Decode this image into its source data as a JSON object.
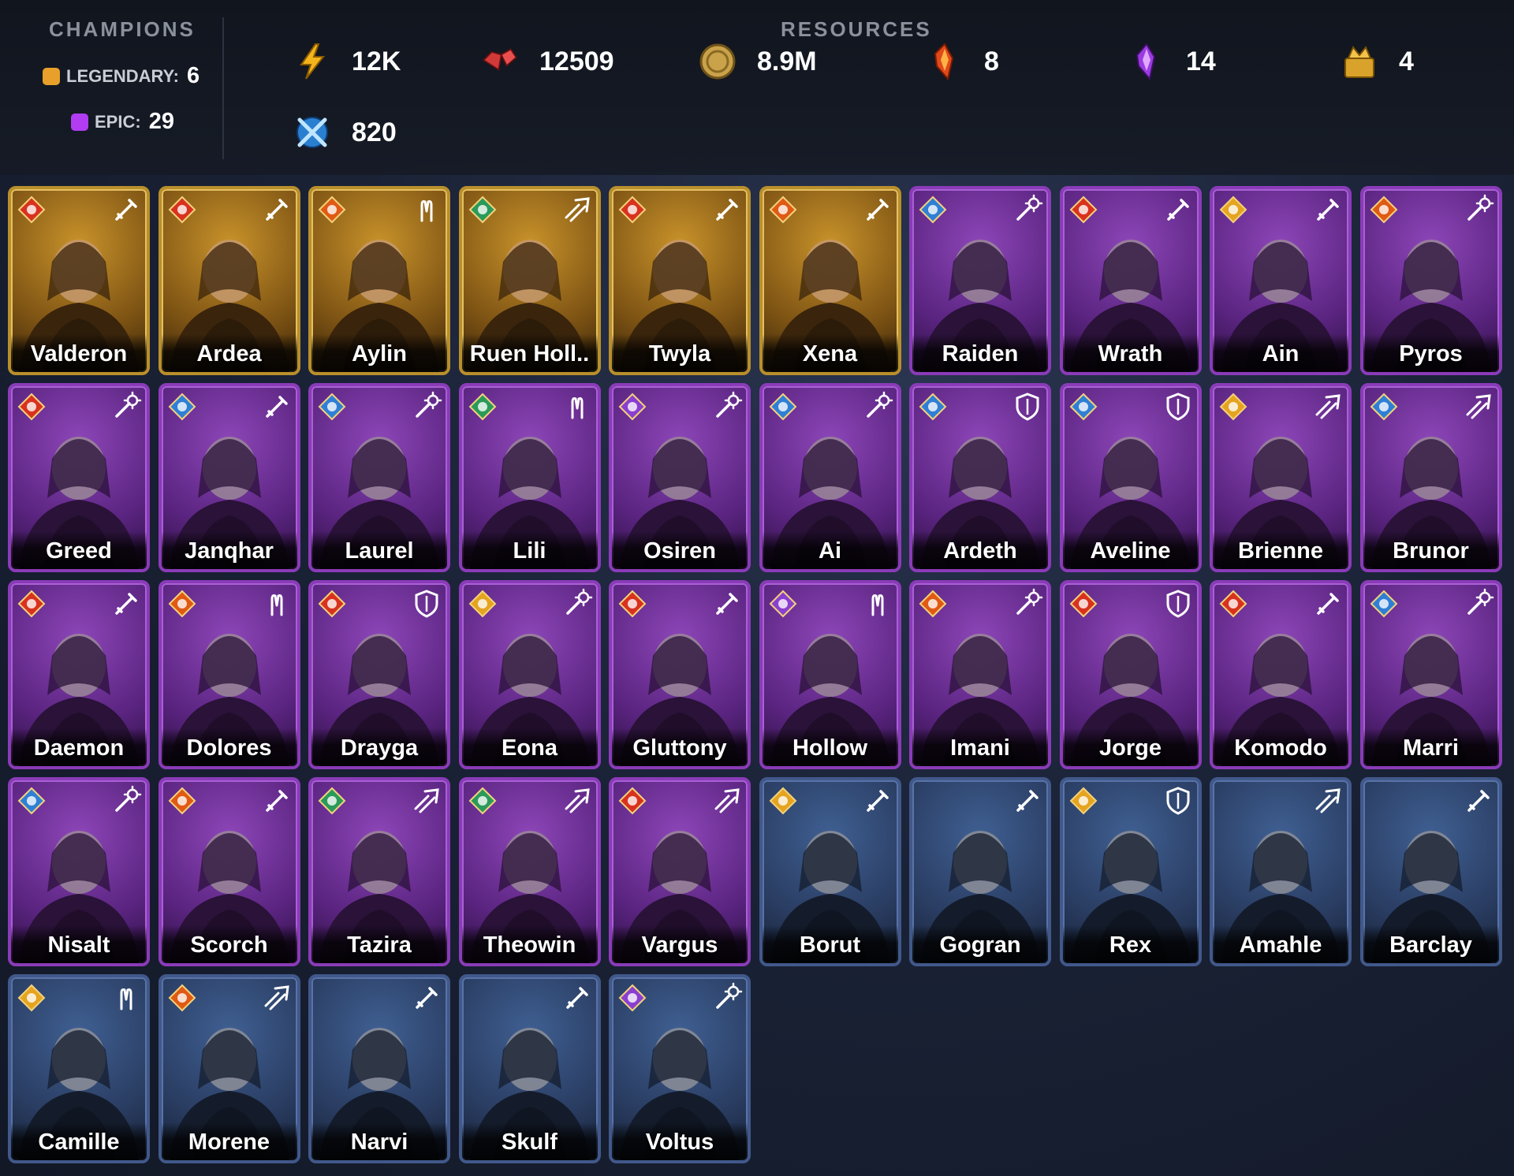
{
  "header": {
    "champions_title": "CHAMPIONS",
    "legendary_label": "LEGENDARY:",
    "legendary_count": "6",
    "epic_label": "EPIC:",
    "epic_count": "29",
    "resources_title": "RESOURCES",
    "resources": [
      {
        "icon": "energy-bolt-icon",
        "value": "12K"
      },
      {
        "icon": "gem-icon",
        "value": "12509"
      },
      {
        "icon": "silver-coin-icon",
        "value": "8.9M"
      },
      {
        "icon": "red-shard-icon",
        "value": "8"
      },
      {
        "icon": "purple-shard-icon",
        "value": "14"
      },
      {
        "icon": "gold-tokens-icon",
        "value": "4"
      },
      {
        "icon": "arena-token-icon",
        "value": "820"
      }
    ]
  },
  "colors": {
    "legendary": "#e8a02a",
    "epic": "#b13cf2",
    "rare": "#4a66a0"
  },
  "champions": [
    {
      "name": "Valderon",
      "rarity": "legendary",
      "role": "attack",
      "affinity": "force"
    },
    {
      "name": "Ardea",
      "rarity": "legendary",
      "role": "attack",
      "affinity": "force"
    },
    {
      "name": "Aylin",
      "rarity": "legendary",
      "role": "support",
      "affinity": "fire"
    },
    {
      "name": "Ruen Holl..",
      "rarity": "legendary",
      "role": "speed",
      "affinity": "nature"
    },
    {
      "name": "Twyla",
      "rarity": "legendary",
      "role": "attack",
      "affinity": "force"
    },
    {
      "name": "Xena",
      "rarity": "legendary",
      "role": "attack",
      "affinity": "fire"
    },
    {
      "name": "Raiden",
      "rarity": "epic",
      "role": "magic",
      "affinity": "water"
    },
    {
      "name": "Wrath",
      "rarity": "epic",
      "role": "attack",
      "affinity": "force"
    },
    {
      "name": "Ain",
      "rarity": "epic",
      "role": "attack",
      "affinity": "light"
    },
    {
      "name": "Pyros",
      "rarity": "epic",
      "role": "magic",
      "affinity": "fire"
    },
    {
      "name": "Greed",
      "rarity": "epic",
      "role": "magic",
      "affinity": "force"
    },
    {
      "name": "Janqhar",
      "rarity": "epic",
      "role": "attack",
      "affinity": "water"
    },
    {
      "name": "Laurel",
      "rarity": "epic",
      "role": "magic",
      "affinity": "water"
    },
    {
      "name": "Lili",
      "rarity": "epic",
      "role": "support",
      "affinity": "nature"
    },
    {
      "name": "Osiren",
      "rarity": "epic",
      "role": "magic",
      "affinity": "void"
    },
    {
      "name": "Ai",
      "rarity": "epic",
      "role": "magic",
      "affinity": "water"
    },
    {
      "name": "Ardeth",
      "rarity": "epic",
      "role": "defense",
      "affinity": "water"
    },
    {
      "name": "Aveline",
      "rarity": "epic",
      "role": "defense",
      "affinity": "water"
    },
    {
      "name": "Brienne",
      "rarity": "epic",
      "role": "speed",
      "affinity": "light"
    },
    {
      "name": "Brunor",
      "rarity": "epic",
      "role": "speed",
      "affinity": "water"
    },
    {
      "name": "Daemon",
      "rarity": "epic",
      "role": "attack",
      "affinity": "force"
    },
    {
      "name": "Dolores",
      "rarity": "epic",
      "role": "support",
      "affinity": "fire"
    },
    {
      "name": "Drayga",
      "rarity": "epic",
      "role": "defense",
      "affinity": "force"
    },
    {
      "name": "Eona",
      "rarity": "epic",
      "role": "magic",
      "affinity": "light"
    },
    {
      "name": "Gluttony",
      "rarity": "epic",
      "role": "attack",
      "affinity": "force"
    },
    {
      "name": "Hollow",
      "rarity": "epic",
      "role": "support",
      "affinity": "void"
    },
    {
      "name": "Imani",
      "rarity": "epic",
      "role": "magic",
      "affinity": "fire"
    },
    {
      "name": "Jorge",
      "rarity": "epic",
      "role": "defense",
      "affinity": "force"
    },
    {
      "name": "Komodo",
      "rarity": "epic",
      "role": "attack",
      "affinity": "force"
    },
    {
      "name": "Marri",
      "rarity": "epic",
      "role": "magic",
      "affinity": "water"
    },
    {
      "name": "Nisalt",
      "rarity": "epic",
      "role": "magic",
      "affinity": "water"
    },
    {
      "name": "Scorch",
      "rarity": "epic",
      "role": "attack",
      "affinity": "fire"
    },
    {
      "name": "Tazira",
      "rarity": "epic",
      "role": "speed",
      "affinity": "nature"
    },
    {
      "name": "Theowin",
      "rarity": "epic",
      "role": "speed",
      "affinity": "nature"
    },
    {
      "name": "Vargus",
      "rarity": "epic",
      "role": "speed",
      "affinity": "force"
    },
    {
      "name": "Borut",
      "rarity": "rare",
      "role": "attack",
      "affinity": "light"
    },
    {
      "name": "Gogran",
      "rarity": "rare",
      "role": "attack",
      "affinity": ""
    },
    {
      "name": "Rex",
      "rarity": "rare",
      "role": "defense",
      "affinity": "light"
    },
    {
      "name": "Amahle",
      "rarity": "rare",
      "role": "speed",
      "affinity": ""
    },
    {
      "name": "Barclay",
      "rarity": "rare",
      "role": "attack",
      "affinity": ""
    },
    {
      "name": "Camille",
      "rarity": "rare",
      "role": "support",
      "affinity": "light"
    },
    {
      "name": "Morene",
      "rarity": "rare",
      "role": "speed",
      "affinity": "fire"
    },
    {
      "name": "Narvi",
      "rarity": "rare",
      "role": "attack",
      "affinity": ""
    },
    {
      "name": "Skulf",
      "rarity": "rare",
      "role": "attack",
      "affinity": ""
    },
    {
      "name": "Voltus",
      "rarity": "rare",
      "role": "magic",
      "affinity": "void"
    }
  ]
}
